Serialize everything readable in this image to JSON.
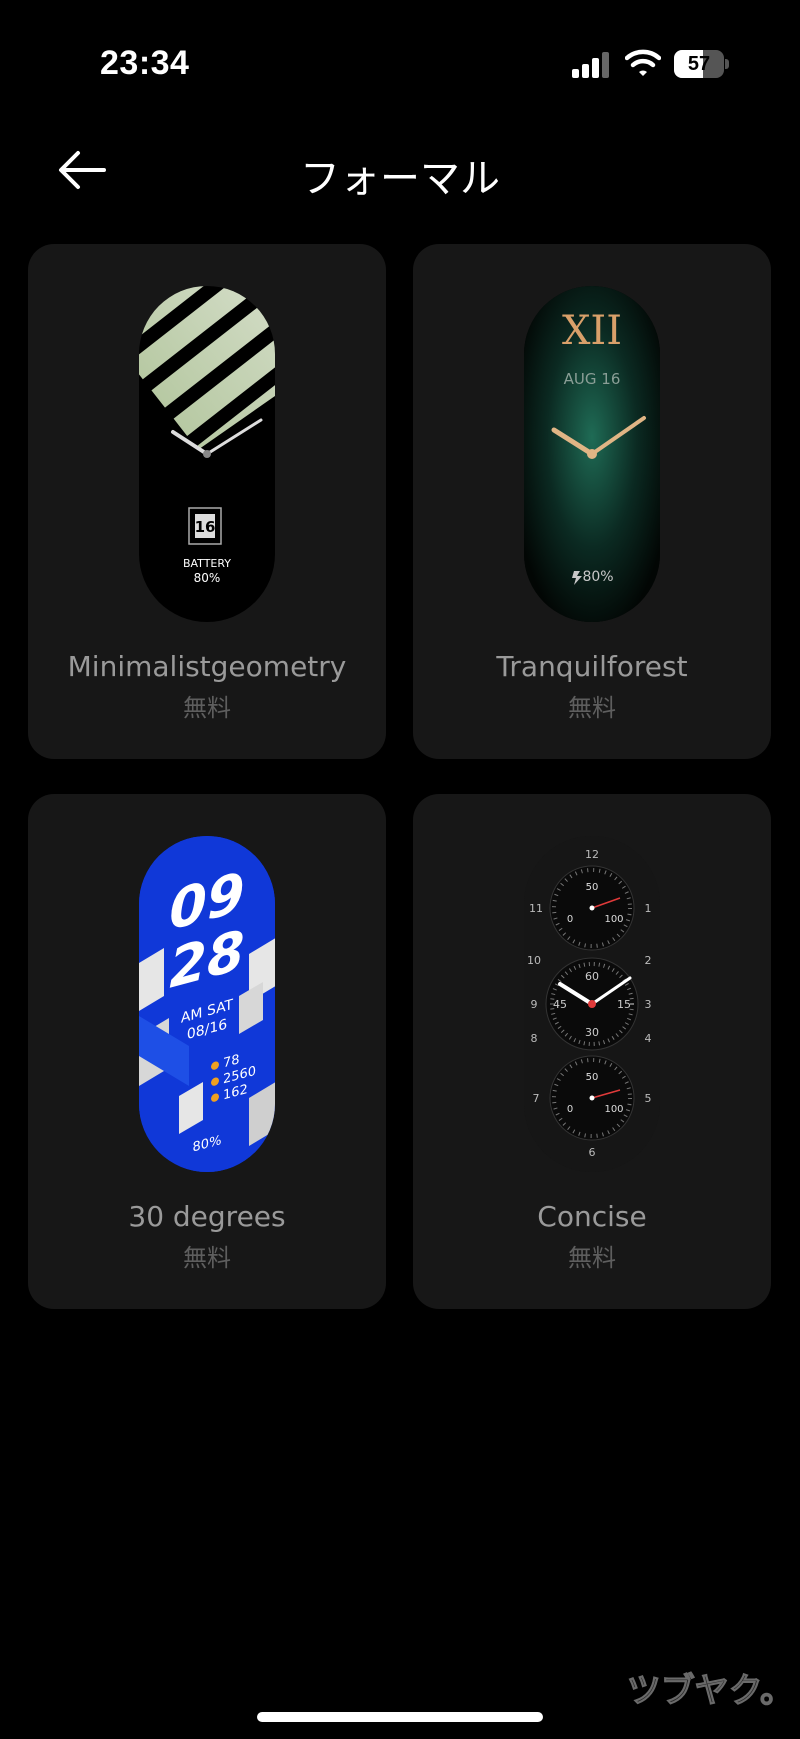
{
  "status_bar": {
    "time": "23:34",
    "battery_level": "57",
    "battery_fraction": 0.57
  },
  "header": {
    "title": "フォーマル",
    "back_icon": "arrow-left-icon"
  },
  "faces": [
    {
      "name": "Minimalistgeometry",
      "price": "無料",
      "date": "16",
      "battery_label": "BATTERY",
      "battery_value": "80%"
    },
    {
      "name": "Tranquilforest",
      "price": "無料",
      "numeral": "XII",
      "date": "AUG 16",
      "battery_value": "80%"
    },
    {
      "name": "30 degrees",
      "price": "無料",
      "hour": "09",
      "minute": "28",
      "ampm_day": "AM SAT",
      "date": "08/16",
      "stat1": "78",
      "stat2": "2560",
      "stat3": "162",
      "battery_value": "80%"
    },
    {
      "name": "Concise",
      "price": "無料",
      "dial_top": {
        "hour_top": "12",
        "hour_left": "11",
        "hour_right": "1",
        "v50": "50",
        "v0": "0",
        "v100": "100"
      },
      "dial_mid": {
        "h10": "10",
        "h2": "2",
        "h9": "9",
        "h3": "3",
        "h8": "8",
        "h4": "4",
        "v60": "60",
        "v45": "45",
        "v15": "15",
        "v30": "30"
      },
      "dial_bot": {
        "h7": "7",
        "h5": "5",
        "h6": "6",
        "v50": "50",
        "v0": "0",
        "v100": "100"
      }
    }
  ],
  "watermark": "ツブヤク。",
  "colors": {
    "background": "#000000",
    "card": "#171717",
    "accent_blue": "#1038d8",
    "forest_green": "#1f6b55",
    "gold": "#d9a06a"
  }
}
